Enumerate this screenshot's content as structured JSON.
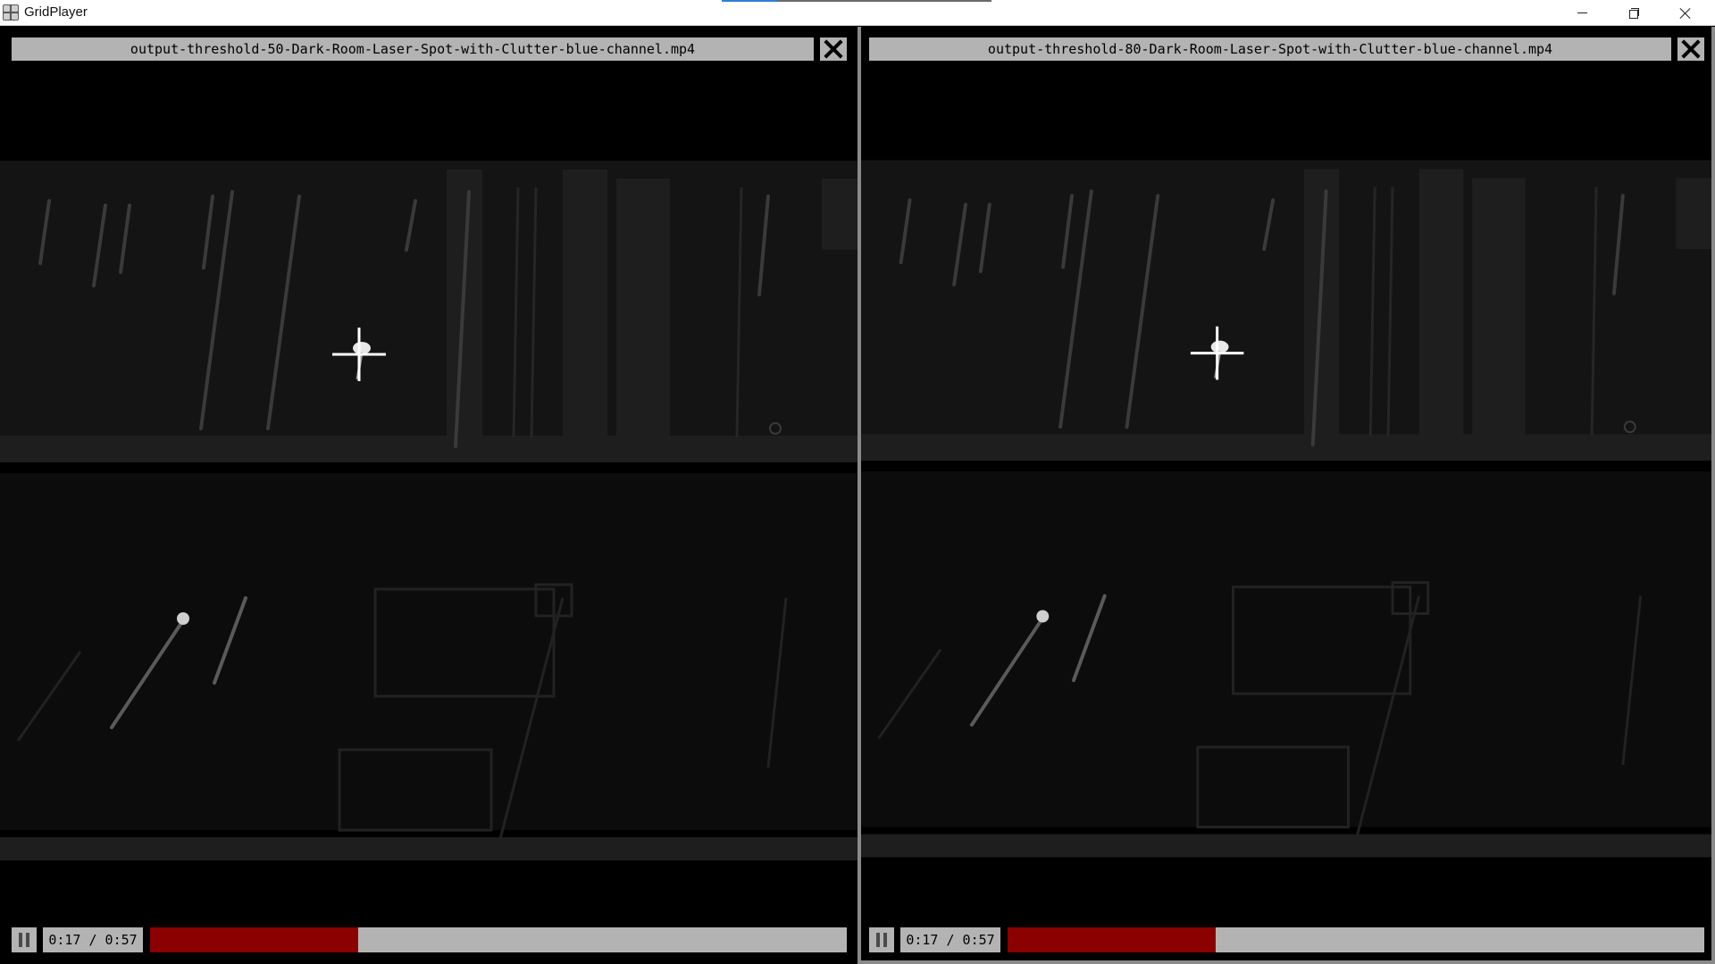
{
  "window": {
    "title": "GridPlayer",
    "icon": "grid-app-icon"
  },
  "colors": {
    "bar_gray": "#b3b3b3",
    "seek_fill": "#8b0000",
    "active_border": "#8a8a8a"
  },
  "panes": [
    {
      "filename": "output-threshold-50-Dark-Room-Laser-Spot-with-Clutter-blue-channel.mp4",
      "time": "0:17 / 0:57",
      "progress_fraction": 0.2982,
      "state": "playing",
      "pause_icon": "pause-icon",
      "close_icon": "close-icon"
    },
    {
      "filename": "output-threshold-80-Dark-Room-Laser-Spot-with-Clutter-blue-channel.mp4",
      "time": "0:17 / 0:57",
      "progress_fraction": 0.2982,
      "state": "playing",
      "pause_icon": "pause-icon",
      "close_icon": "close-icon"
    }
  ]
}
